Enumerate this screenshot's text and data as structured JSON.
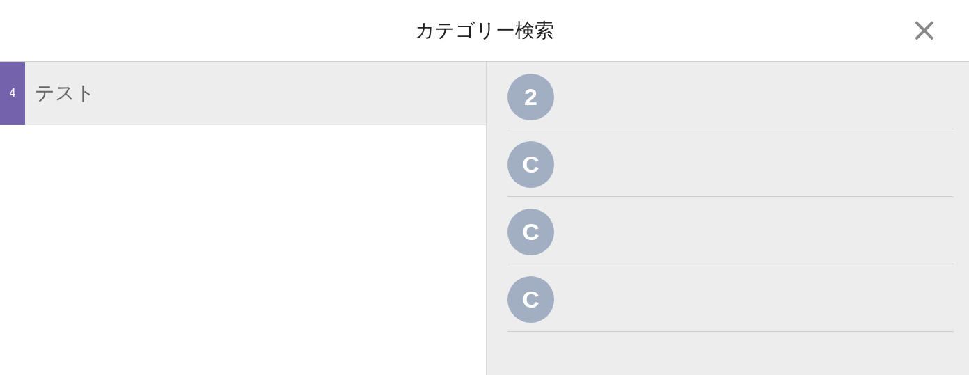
{
  "header": {
    "title": "カテゴリー検索",
    "close_label": "×"
  },
  "categories": [
    {
      "count": "4",
      "label": "テスト",
      "selected": true
    }
  ],
  "items": [
    {
      "initial": "2"
    },
    {
      "initial": "C"
    },
    {
      "initial": "C"
    },
    {
      "initial": "C"
    }
  ]
}
